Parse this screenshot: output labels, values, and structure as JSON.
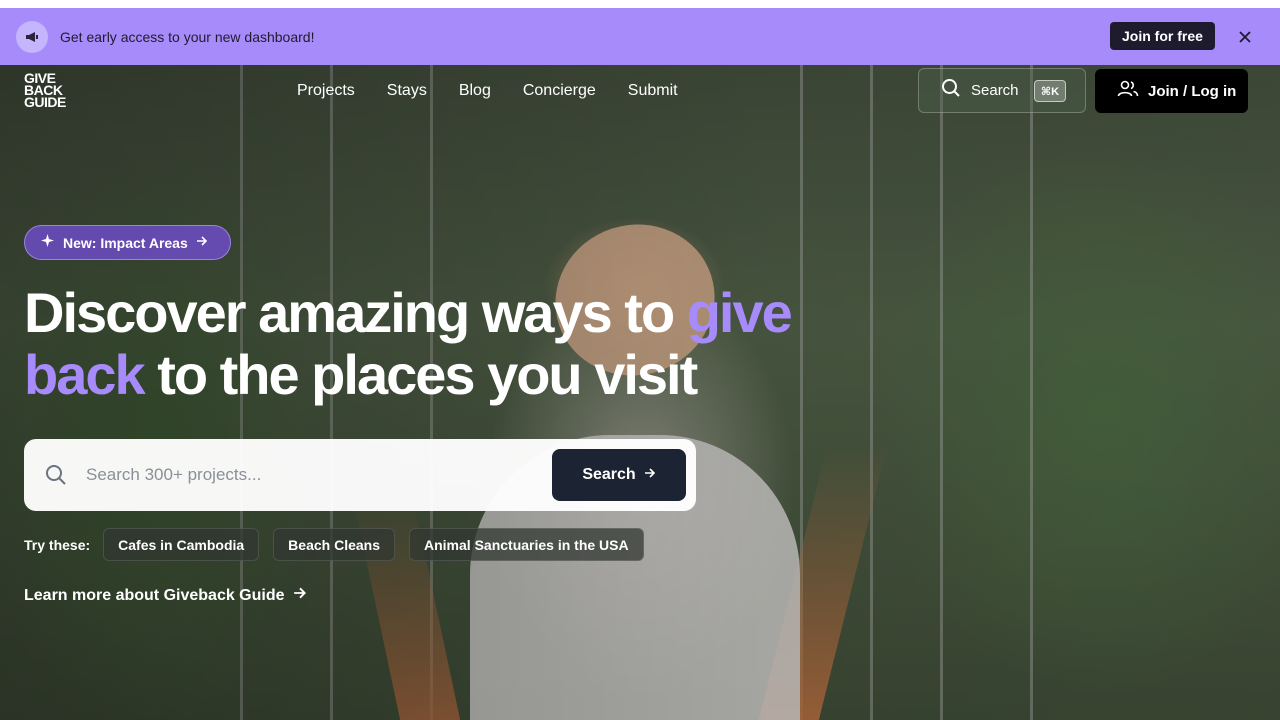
{
  "banner": {
    "icon": "megaphone-icon",
    "text": "Get early access to your new dashboard!",
    "cta_label": "Join for free",
    "close_icon": "close-icon",
    "background_color": "#a78bfa"
  },
  "header": {
    "logo_lines": [
      "GIVE",
      "BACK",
      "GUIDE"
    ],
    "nav": [
      "Projects",
      "Stays",
      "Blog",
      "Concierge",
      "Submit"
    ],
    "search_label": "Search",
    "search_shortcut": "⌘K",
    "login_label": "Join / Log in"
  },
  "hero": {
    "badge_label": "New: Impact Areas",
    "headline": {
      "part1": "Discover amazing ways to ",
      "accent1": "give",
      "accent2": "back",
      "part2": " to the places you visit"
    },
    "accent_color": "#a78bfa",
    "search": {
      "placeholder": "Search 300+ projects...",
      "value": "",
      "button_label": "Search"
    },
    "try_label": "Try these:",
    "suggestions": [
      "Cafes in Cambodia",
      "Beach Cleans",
      "Animal Sanctuaries in the USA"
    ],
    "learn_more": "Learn more about Giveback Guide"
  }
}
